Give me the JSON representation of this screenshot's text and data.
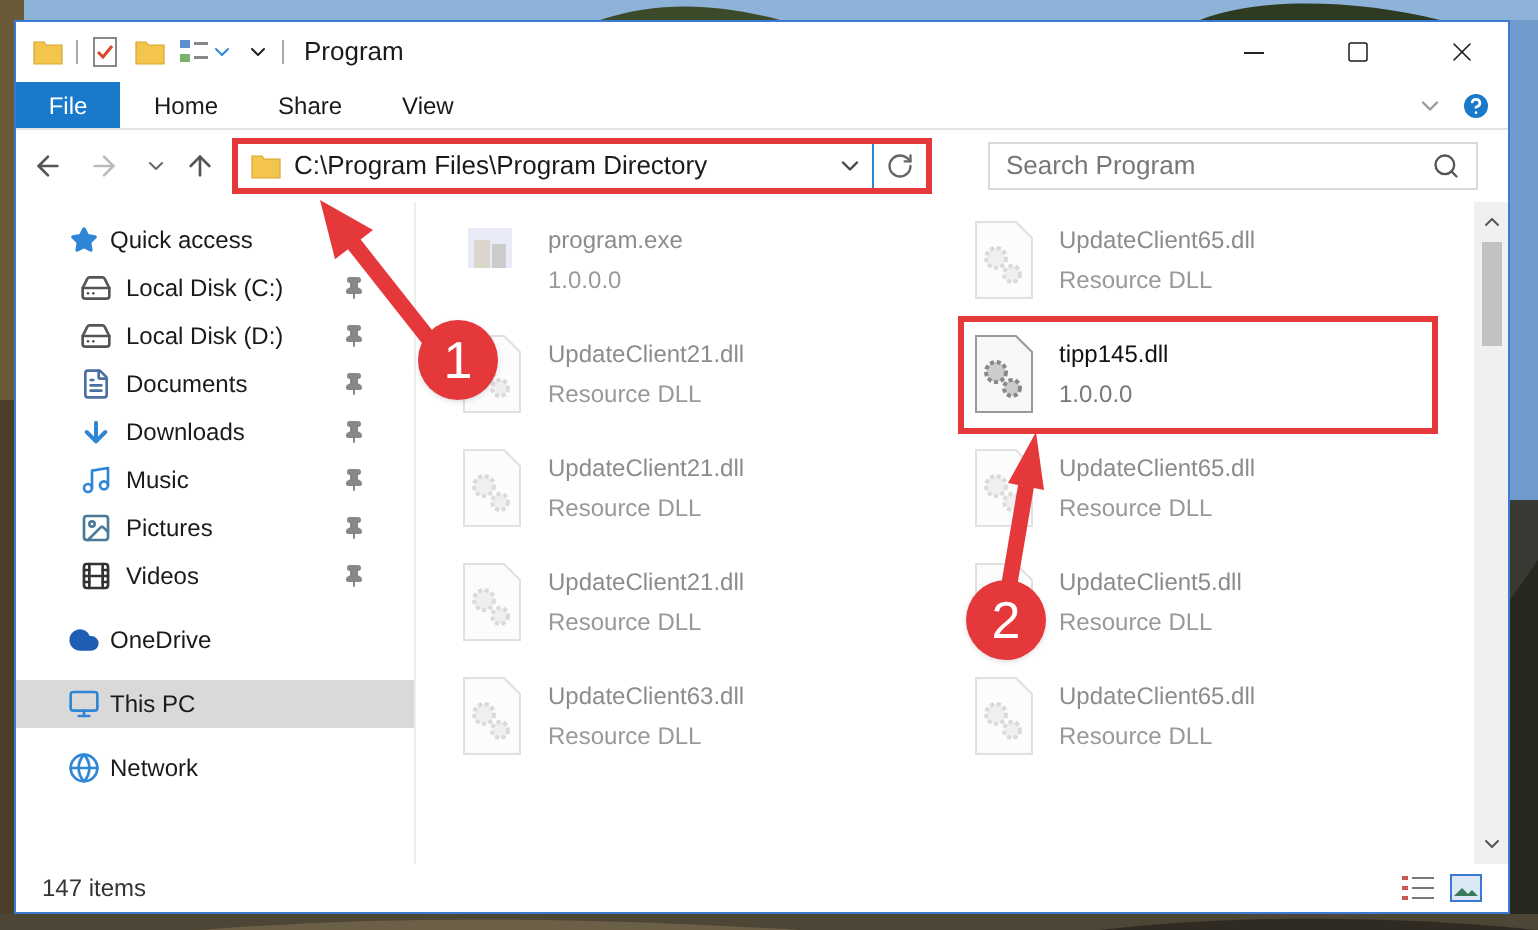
{
  "window": {
    "title": "Program"
  },
  "ribbon": {
    "file_tab": "File",
    "tabs": [
      "Home",
      "Share",
      "View"
    ]
  },
  "address": {
    "path": "C:\\Program Files\\Program Directory"
  },
  "search": {
    "placeholder": "Search Program"
  },
  "sidebar": {
    "items": [
      {
        "label": "Quick access",
        "kind": "quick",
        "pinned": false,
        "selected": false
      },
      {
        "label": "Local Disk (C:)",
        "kind": "drive_c",
        "pinned": true,
        "selected": false
      },
      {
        "label": "Local Disk (D:)",
        "kind": "drive",
        "pinned": true,
        "selected": false
      },
      {
        "label": "Documents",
        "kind": "documents",
        "pinned": true,
        "selected": false
      },
      {
        "label": "Downloads",
        "kind": "downloads",
        "pinned": true,
        "selected": false
      },
      {
        "label": "Music",
        "kind": "music",
        "pinned": true,
        "selected": false
      },
      {
        "label": "Pictures",
        "kind": "pictures",
        "pinned": true,
        "selected": false
      },
      {
        "label": "Videos",
        "kind": "videos",
        "pinned": true,
        "selected": false
      },
      {
        "label": "OneDrive",
        "kind": "onedrive",
        "pinned": false,
        "selected": false
      },
      {
        "label": "This PC",
        "kind": "pc",
        "pinned": false,
        "selected": true
      },
      {
        "label": "Network",
        "kind": "network",
        "pinned": false,
        "selected": false
      }
    ]
  },
  "files": [
    {
      "name": "program.exe",
      "detail": "1.0.0.0",
      "kind": "exe",
      "faded": true
    },
    {
      "name": "UpdateClient65.dll",
      "detail": "Resource DLL",
      "kind": "dll",
      "faded": true
    },
    {
      "name": "UpdateClient21.dll",
      "detail": "Resource DLL",
      "kind": "dll",
      "faded": true
    },
    {
      "name": "tipp145.dll",
      "detail": "1.0.0.0",
      "kind": "dll",
      "faded": false
    },
    {
      "name": "UpdateClient21.dll",
      "detail": "Resource DLL",
      "kind": "dll",
      "faded": true
    },
    {
      "name": "UpdateClient65.dll",
      "detail": "Resource DLL",
      "kind": "dll",
      "faded": true
    },
    {
      "name": "UpdateClient21.dll",
      "detail": "Resource DLL",
      "kind": "dll",
      "faded": true
    },
    {
      "name": "UpdateClient5.dll",
      "detail": "Resource DLL",
      "kind": "dll",
      "faded": true
    },
    {
      "name": "UpdateClient63.dll",
      "detail": "Resource DLL",
      "kind": "dll",
      "faded": true
    },
    {
      "name": "UpdateClient65.dll",
      "detail": "Resource DLL",
      "kind": "dll",
      "faded": true
    }
  ],
  "status_bar": {
    "count": "147 items"
  },
  "annotations": [
    {
      "number": "1"
    },
    {
      "number": "2"
    }
  ]
}
